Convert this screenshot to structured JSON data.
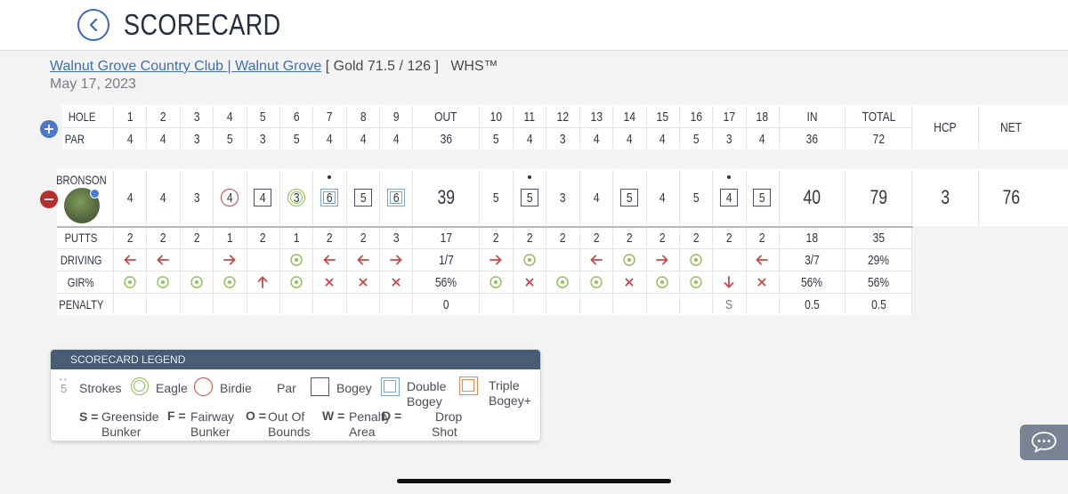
{
  "header": {
    "title": "SCORECARD"
  },
  "course": {
    "link": "Walnut Grove Country Club | Walnut Grove",
    "tee": "[ Gold 71.5 / 126 ]",
    "whs": "WHS™",
    "date": "May 17, 2023"
  },
  "table": {
    "hole_label": "HOLE",
    "par_label": "PAR",
    "holes_front": [
      "1",
      "2",
      "3",
      "4",
      "5",
      "6",
      "7",
      "8",
      "9"
    ],
    "out_label": "OUT",
    "holes_back": [
      "10",
      "11",
      "12",
      "13",
      "14",
      "15",
      "16",
      "17",
      "18"
    ],
    "in_label": "IN",
    "total_label": "TOTAL",
    "hcp_label": "HCP",
    "net_label": "NET",
    "par_front": [
      "4",
      "4",
      "3",
      "5",
      "3",
      "5",
      "4",
      "4",
      "4"
    ],
    "par_out": "36",
    "par_back": [
      "5",
      "4",
      "3",
      "4",
      "4",
      "4",
      "5",
      "3",
      "4"
    ],
    "par_in": "36",
    "par_total": "72"
  },
  "player": {
    "name": "BRONSON",
    "scores_front": [
      "4",
      "4",
      "3",
      "4",
      "4",
      "3",
      "6",
      "5",
      "6"
    ],
    "types_front": [
      "par",
      "par",
      "par",
      "birdie",
      "bogey",
      "eagle",
      "double",
      "bogey",
      "double"
    ],
    "dots_front": [
      false,
      false,
      false,
      false,
      false,
      false,
      true,
      false,
      false
    ],
    "out": "39",
    "scores_back": [
      "5",
      "5",
      "3",
      "4",
      "5",
      "4",
      "5",
      "4",
      "5"
    ],
    "types_back": [
      "par",
      "bogey",
      "par",
      "par",
      "bogey",
      "par",
      "par",
      "bogey",
      "bogey"
    ],
    "dots_back": [
      false,
      true,
      false,
      false,
      false,
      false,
      false,
      true,
      false
    ],
    "in": "40",
    "total": "79",
    "hcp": "3",
    "net": "76"
  },
  "stats": {
    "putts_label": "PUTTS",
    "putts_front": [
      "2",
      "2",
      "2",
      "1",
      "2",
      "1",
      "2",
      "2",
      "3"
    ],
    "putts_out": "17",
    "putts_back": [
      "2",
      "2",
      "2",
      "2",
      "2",
      "2",
      "2",
      "2",
      "2"
    ],
    "putts_in": "18",
    "putts_total": "35",
    "driving_label": "DRIVING",
    "driving_front": [
      "left",
      "left",
      "",
      "right",
      "",
      "hit",
      "left",
      "left",
      "right"
    ],
    "driving_out": "1/7",
    "driving_back": [
      "right",
      "hit",
      "",
      "left",
      "hit",
      "right",
      "hit",
      "",
      "left"
    ],
    "driving_in": "3/7",
    "driving_total": "29%",
    "gir_label": "GIR%",
    "gir_front": [
      "hit",
      "hit",
      "hit",
      "hit",
      "up",
      "hit",
      "miss",
      "miss",
      "miss"
    ],
    "gir_out": "56%",
    "gir_back": [
      "hit",
      "miss",
      "hit",
      "hit",
      "miss",
      "hit",
      "hit",
      "down",
      "miss"
    ],
    "gir_in": "56%",
    "gir_total": "56%",
    "penalty_label": "PENALTY",
    "penalty_front": [
      "",
      "",
      "",
      "",
      "",
      "",
      "",
      "",
      ""
    ],
    "penalty_out": "0",
    "penalty_back": [
      "",
      "",
      "",
      "",
      "",
      "",
      "",
      "S",
      ""
    ],
    "penalty_in": "0.5",
    "penalty_total": "0.5"
  },
  "legend": {
    "title": "SCORECARD LEGEND",
    "strokes_sample": "5",
    "strokes": "Strokes",
    "eagle": "Eagle",
    "birdie": "Birdie",
    "par": "Par",
    "bogey": "Bogey",
    "double_1": "Double",
    "double_2": "Bogey",
    "triple_1": "Triple",
    "triple_2": "Bogey+",
    "s_key": "S =",
    "s_1": "Greenside",
    "s_2": "Bunker",
    "f_key": "F =",
    "f_1": "Fairway",
    "f_2": "Bunker",
    "o_key": "O =",
    "o_1": "Out Of",
    "o_2": "Bounds",
    "w_key": "W =",
    "w_1": "Penalty",
    "w_2": "Area",
    "d_key": "D =",
    "d_1": "Drop",
    "d_2": "Shot"
  },
  "colors": {
    "accent_blue": "#3d68b3",
    "eagle_green": "#8fbf55",
    "birdie_red": "#b34747",
    "bogey_navy": "#4a4e7a",
    "double_blue": "#7fa6c8",
    "triple_orange": "#e8895a",
    "miss_red": "#c94848",
    "legend_header": "#485c73"
  },
  "icons": {
    "back": "chevron-left-icon",
    "expand": "plus-icon",
    "collapse": "minus-icon",
    "chat": "chat-bubble-icon"
  }
}
